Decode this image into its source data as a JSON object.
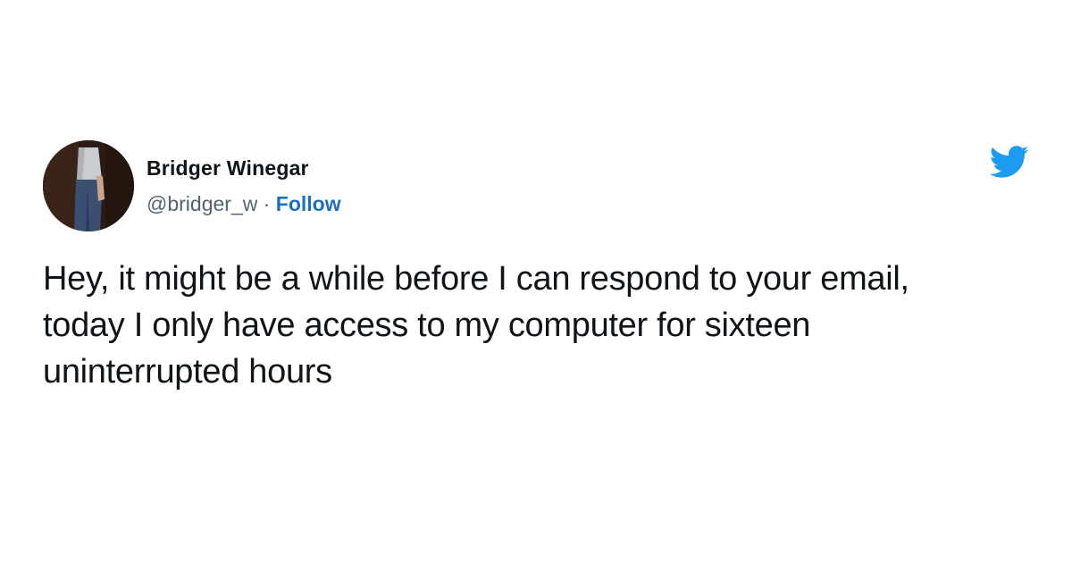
{
  "author": {
    "display_name": "Bridger Winegar",
    "handle": "@bridger_w",
    "separator": " · ",
    "follow_label": "Follow"
  },
  "tweet": {
    "lines": [
      "Hey, it might be a while before I can respond to your email,",
      "today I only have access to my computer for sixteen",
      "uninterrupted hours"
    ]
  },
  "brand": {
    "icon": "twitter-bird-icon",
    "accent_color": "#1d9bf0",
    "link_color": "#1b6fbe"
  }
}
